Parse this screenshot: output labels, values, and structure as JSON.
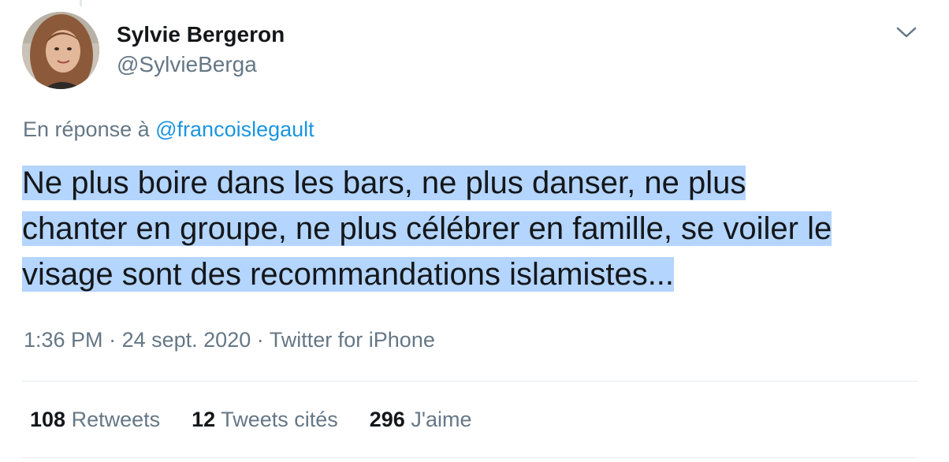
{
  "tweet": {
    "author": {
      "display_name": "Sylvie Bergeron",
      "handle": "@SylvieBerga"
    },
    "reply_to": {
      "prefix": "En réponse à",
      "mention": "@francoislegault"
    },
    "text_lines": [
      "Ne plus boire dans les bars, ne plus danser, ne plus",
      "chanter en groupe, ne plus célébrer en famille, se voiler le",
      "visage sont des recommandations islamistes..."
    ],
    "time": "1:36 PM",
    "separator": "·",
    "date": "24 sept. 2020",
    "source": "Twitter for iPhone",
    "stats": {
      "retweets": {
        "count": "108",
        "label": "Retweets"
      },
      "quotes": {
        "count": "12",
        "label": "Tweets cités"
      },
      "likes": {
        "count": "296",
        "label": "J'aime"
      }
    }
  },
  "icons": {
    "menu": "chevron-down-icon"
  },
  "colors": {
    "primary_text": "#14171a",
    "secondary_text": "#657786",
    "link": "#1b95e0",
    "selection_highlight": "#b4d5fe",
    "divider": "#e6ecf0"
  }
}
